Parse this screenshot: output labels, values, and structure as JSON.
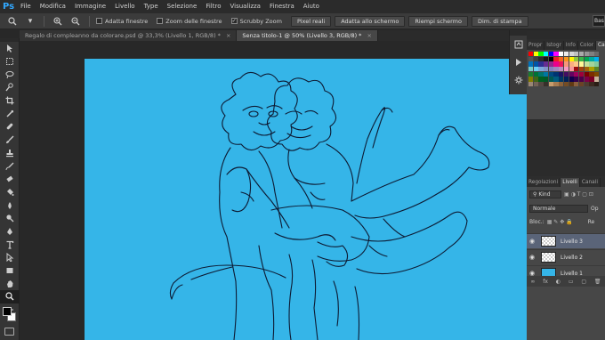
{
  "menubar": {
    "logo": "Ps",
    "items": [
      "File",
      "Modifica",
      "Immagine",
      "Livello",
      "Type",
      "Selezione",
      "Filtro",
      "Visualizza",
      "Finestra",
      "Aiuto"
    ]
  },
  "options": {
    "adatta_finestre": "Adatta finestre",
    "zoom_finestre": "Zoom delle finestre",
    "scrubby_zoom": "Scrubby Zoom",
    "scrubby_checked": "✓",
    "pixel_reali": "Pixel reali",
    "adatta_schermo": "Adatta allo schermo",
    "riempi_schermo": "Riempi schermo",
    "dim_stampa": "Dim. di stampa",
    "workspace": "Base"
  },
  "tabs": [
    {
      "label": "Regalo di compleanno  da colorare.psd @ 33,3% (Livello 1, RGB/8) *",
      "close": "×"
    },
    {
      "label": "Senza titolo-1 @ 50% (Livello 3, RGB/8) *",
      "close": "×"
    }
  ],
  "color_panel": {
    "tabs": [
      "Propr",
      "Istogr",
      "Info",
      "Color",
      "Campi"
    ]
  },
  "layers_panel": {
    "tabs": [
      "Regolazioni",
      "Livelli",
      "Canali"
    ],
    "kind": "Kind",
    "blend": "Normale",
    "opacity_label": "Op",
    "lock_label": "Bloc.:",
    "fill_label": "Re",
    "layers": [
      {
        "name": "Livello 3",
        "selected": true,
        "thumb": "checker"
      },
      {
        "name": "Livello 2",
        "selected": false,
        "thumb": "checker"
      },
      {
        "name": "Livello 1",
        "selected": false,
        "thumb": "blue"
      }
    ],
    "bottom_icons": [
      "fx",
      "◐",
      "▭",
      "▢",
      "🗑"
    ]
  },
  "colors": {
    "canvas": "#35b5e8",
    "lineart": "#0d1a33"
  }
}
